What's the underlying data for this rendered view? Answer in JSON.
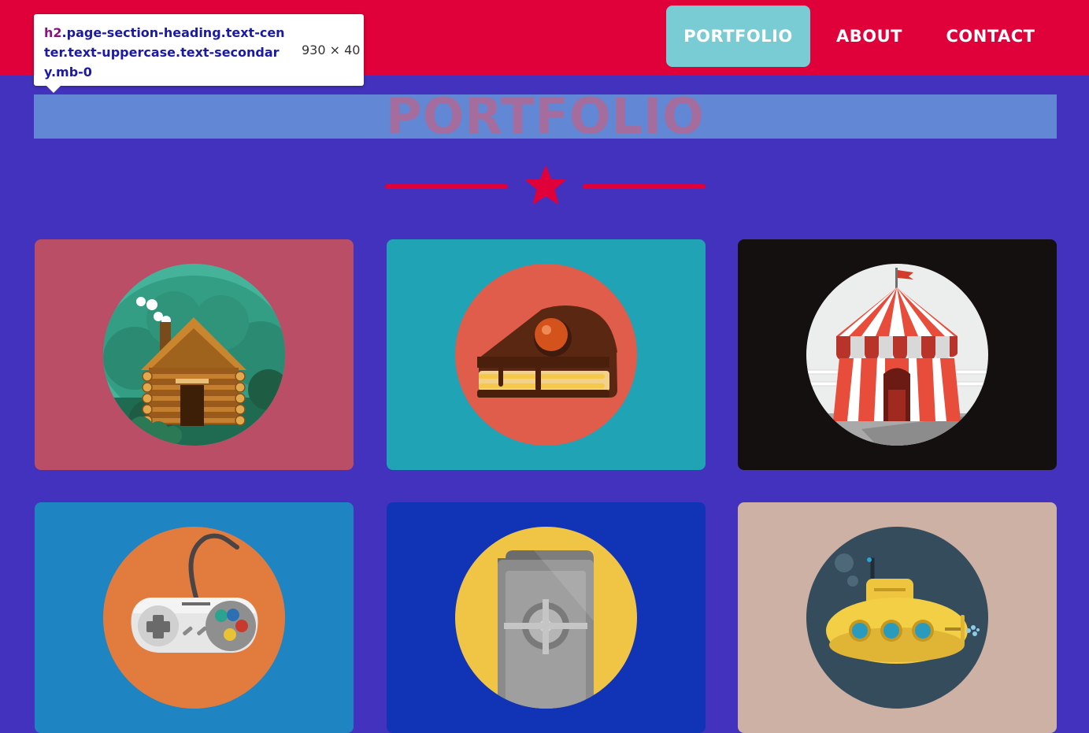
{
  "nav": {
    "items": [
      {
        "label": "PORTFOLIO",
        "active": true
      },
      {
        "label": "ABOUT",
        "active": false
      },
      {
        "label": "CONTACT",
        "active": false
      }
    ]
  },
  "inspector_tooltip": {
    "tag": "h2",
    "classes": ".page-section-heading.text-center.text-uppercase.text-secondary.mb-0",
    "dimensions": "930 × 40"
  },
  "section": {
    "heading": "PORTFOLIO",
    "divider_icon": "star-icon"
  },
  "portfolio": {
    "items": [
      {
        "name": "cabin",
        "icon": "cabin-icon",
        "background": "#b94e66"
      },
      {
        "name": "cake",
        "icon": "cake-icon",
        "background": "#20a3b5"
      },
      {
        "name": "circus",
        "icon": "circus-tent-icon",
        "background": "#141010"
      },
      {
        "name": "game",
        "icon": "game-controller-icon",
        "background": "#1e84c2"
      },
      {
        "name": "safe",
        "icon": "safe-icon",
        "background": "#1134b6"
      },
      {
        "name": "submarine",
        "icon": "submarine-icon",
        "background": "#cdb1a5"
      }
    ]
  },
  "colors": {
    "page_background": "#4232be",
    "navbar": "#e0003a",
    "nav_active": "#79ccd3",
    "accent": "#e0003a"
  }
}
